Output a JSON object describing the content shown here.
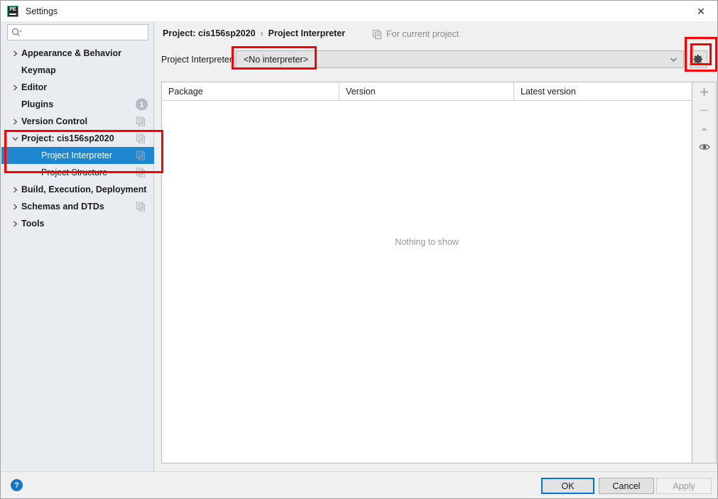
{
  "window": {
    "title": "Settings",
    "app_icon": "pycharm-edu-icon",
    "close_label": "✕"
  },
  "sidebar": {
    "search": {
      "placeholder": "",
      "value": "",
      "icon": "search-icon"
    },
    "items": [
      {
        "label": "Appearance & Behavior",
        "expandable": true,
        "expanded": false,
        "indent": false,
        "selected": false,
        "right_icon": "none",
        "badge": ""
      },
      {
        "label": "Keymap",
        "expandable": false,
        "expanded": false,
        "indent": false,
        "selected": false,
        "right_icon": "none",
        "badge": ""
      },
      {
        "label": "Editor",
        "expandable": true,
        "expanded": false,
        "indent": false,
        "selected": false,
        "right_icon": "none",
        "badge": ""
      },
      {
        "label": "Plugins",
        "expandable": false,
        "expanded": false,
        "indent": false,
        "selected": false,
        "right_icon": "none",
        "badge": "1"
      },
      {
        "label": "Version Control",
        "expandable": true,
        "expanded": false,
        "indent": false,
        "selected": false,
        "right_icon": "copy-icon",
        "badge": ""
      },
      {
        "label": "Project: cis156sp2020",
        "expandable": true,
        "expanded": true,
        "indent": false,
        "selected": false,
        "right_icon": "copy-icon",
        "badge": ""
      },
      {
        "label": "Project Interpreter",
        "expandable": false,
        "expanded": false,
        "indent": true,
        "selected": true,
        "right_icon": "copy-icon",
        "badge": ""
      },
      {
        "label": "Project Structure",
        "expandable": false,
        "expanded": false,
        "indent": true,
        "selected": false,
        "right_icon": "copy-icon",
        "badge": ""
      },
      {
        "label": "Build, Execution, Deployment",
        "expandable": true,
        "expanded": false,
        "indent": false,
        "selected": false,
        "right_icon": "none",
        "badge": ""
      },
      {
        "label": "Schemas and DTDs",
        "expandable": true,
        "expanded": false,
        "indent": false,
        "selected": false,
        "right_icon": "copy-icon",
        "badge": ""
      },
      {
        "label": "Tools",
        "expandable": true,
        "expanded": false,
        "indent": false,
        "selected": false,
        "right_icon": "none",
        "badge": ""
      }
    ]
  },
  "main": {
    "breadcrumb": {
      "root": "Project: cis156sp2020",
      "separator": "›",
      "leaf": "Project Interpreter"
    },
    "for_current_project": {
      "label": "For current project",
      "icon": "copy-icon"
    },
    "interpreter": {
      "label": "Project Interpreter:",
      "value": "<No interpreter>",
      "chevron": "chevron-down-icon",
      "gear_icon": "gear-icon"
    },
    "table": {
      "columns": [
        "Package",
        "Version",
        "Latest version"
      ],
      "rows": [],
      "empty_message": "Nothing to show"
    },
    "side_tools": [
      {
        "name": "add-package-button",
        "glyph": "+"
      },
      {
        "name": "remove-package-button",
        "glyph": "−"
      },
      {
        "name": "upgrade-package-button",
        "glyph": "▲"
      },
      {
        "name": "show-early-releases-button",
        "glyph": "eye"
      }
    ]
  },
  "footer": {
    "help_label": "?",
    "ok_label": "OK",
    "cancel_label": "Cancel",
    "apply_label": "Apply"
  },
  "annotations": {
    "accent_red": "#ff0000",
    "selection_blue": "#1f87cf",
    "focus_blue": "#0078d7"
  }
}
